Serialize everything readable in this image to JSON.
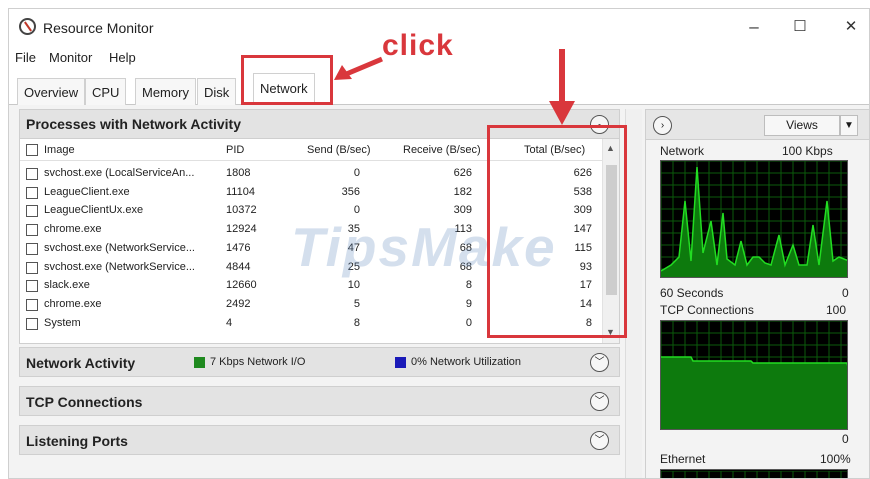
{
  "window": {
    "title": "Resource Monitor",
    "minimize": "–",
    "maximize": "☐",
    "close": "✕"
  },
  "menu": [
    "File",
    "Monitor",
    "Help"
  ],
  "tabs": [
    "Overview",
    "CPU",
    "Memory",
    "Disk",
    "Network"
  ],
  "annotation": {
    "click_label": "click",
    "color": "#d9373c"
  },
  "processes": {
    "title": "Processes with Network Activity",
    "columns": [
      "Image",
      "PID",
      "Send (B/sec)",
      "Receive (B/sec)",
      "Total (B/sec)"
    ],
    "rows": [
      {
        "image": "svchost.exe (LocalServiceAn...",
        "pid": "1808",
        "send": "0",
        "receive": "626",
        "total": "626"
      },
      {
        "image": "LeagueClient.exe",
        "pid": "11104",
        "send": "356",
        "receive": "182",
        "total": "538"
      },
      {
        "image": "LeagueClientUx.exe",
        "pid": "10372",
        "send": "0",
        "receive": "309",
        "total": "309"
      },
      {
        "image": "chrome.exe",
        "pid": "12924",
        "send": "35",
        "receive": "113",
        "total": "147"
      },
      {
        "image": "svchost.exe (NetworkService...",
        "pid": "1476",
        "send": "47",
        "receive": "68",
        "total": "115"
      },
      {
        "image": "svchost.exe (NetworkService...",
        "pid": "4844",
        "send": "25",
        "receive": "68",
        "total": "93"
      },
      {
        "image": "slack.exe",
        "pid": "12660",
        "send": "10",
        "receive": "8",
        "total": "17"
      },
      {
        "image": "chrome.exe",
        "pid": "2492",
        "send": "5",
        "receive": "9",
        "total": "14"
      },
      {
        "image": "System",
        "pid": "4",
        "send": "8",
        "receive": "0",
        "total": "8"
      }
    ]
  },
  "network_activity": {
    "title": "Network Activity",
    "io_label": "7 Kbps Network I/O",
    "io_color": "#1f8a1f",
    "util_label": "0% Network Utilization",
    "util_color": "#1a1ab8"
  },
  "tcp_connections": {
    "title": "TCP Connections"
  },
  "listening_ports": {
    "title": "Listening Ports"
  },
  "right_panel": {
    "views_label": "Views",
    "network": {
      "label": "Network",
      "max": "100 Kbps",
      "time": "60 Seconds",
      "min": "0"
    },
    "tcp": {
      "label": "TCP Connections",
      "max": "100",
      "min": "0"
    },
    "ethernet": {
      "label": "Ethernet",
      "max": "100%"
    },
    "graph_line_color": "#22dd22",
    "graph_fill_color": "#0d7a0d"
  },
  "watermark": "TipsMake"
}
